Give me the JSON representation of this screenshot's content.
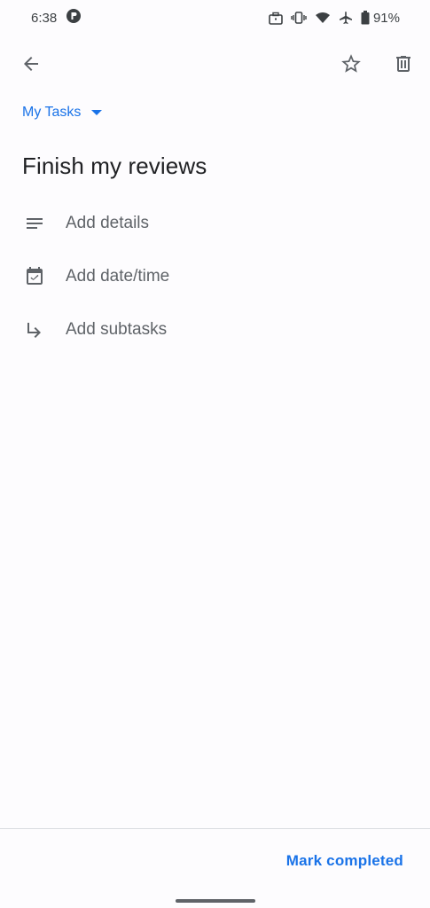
{
  "status_bar": {
    "time": "6:38",
    "battery": "91%",
    "icons": [
      "media-icon",
      "briefcase-icon",
      "vibrate-icon",
      "wifi-icon",
      "airplane-icon",
      "battery-icon"
    ]
  },
  "app_bar": {
    "icons": [
      "back-arrow-icon",
      "star-icon",
      "delete-icon"
    ]
  },
  "task": {
    "list_name": "My Tasks",
    "title": "Finish my reviews",
    "rows": [
      {
        "icon": "notes-icon",
        "label": "Add details"
      },
      {
        "icon": "calendar-check-icon",
        "label": "Add date/time"
      },
      {
        "icon": "subtask-arrow-icon",
        "label": "Add subtasks"
      }
    ]
  },
  "footer": {
    "action": "Mark completed"
  },
  "colors": {
    "accent": "#1a73e8",
    "text_primary": "#202124",
    "text_secondary": "#5f6368",
    "background": "#fdfcfe"
  }
}
